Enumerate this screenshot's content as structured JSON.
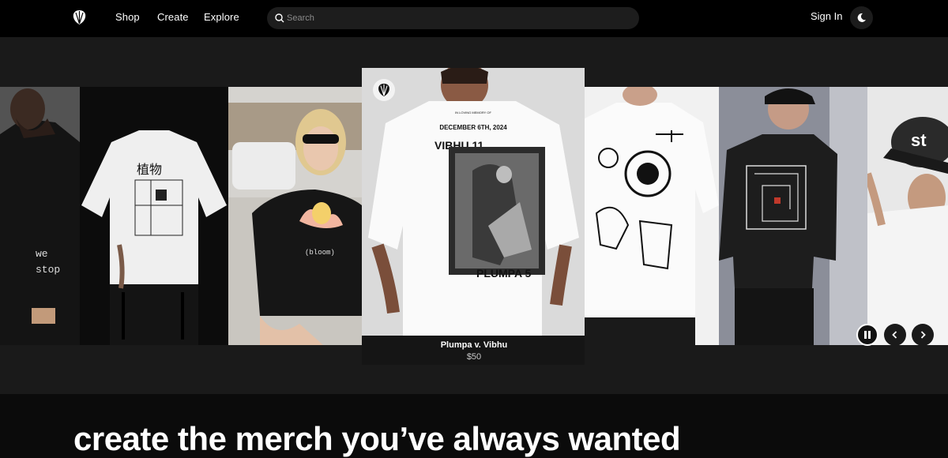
{
  "nav": {
    "logo_icon": "shell-icon",
    "links": [
      "Shop",
      "Create",
      "Explore"
    ],
    "search_placeholder": "Search",
    "signin_label": "Sign In",
    "theme_icon": "moon-icon"
  },
  "carousel": {
    "featured": {
      "title": "Plumpa v. Vibhu",
      "price": "$50",
      "print_headline": "DECEMBER 6TH, 2024",
      "print_name_top": "VIBHU 11",
      "print_name_bottom": "PLUMPA 5",
      "print_memory": "IN LOVING MEMORY OF"
    },
    "items": [
      {
        "print": "we stop",
        "shirt": "black"
      },
      {
        "print": "植物",
        "shirt": "white"
      },
      {
        "print": "(bloom)",
        "shirt": "black"
      },
      {
        "print": "sun glyphs",
        "shirt": "white"
      },
      {
        "print": "maze",
        "shirt": "black"
      },
      {
        "print": "st",
        "shirt": "white"
      }
    ],
    "controls": {
      "pause_icon": "pause-icon",
      "prev_icon": "chevron-left-icon",
      "next_icon": "chevron-right-icon"
    }
  },
  "section": {
    "heading": "create the merch you’ve always wanted"
  }
}
